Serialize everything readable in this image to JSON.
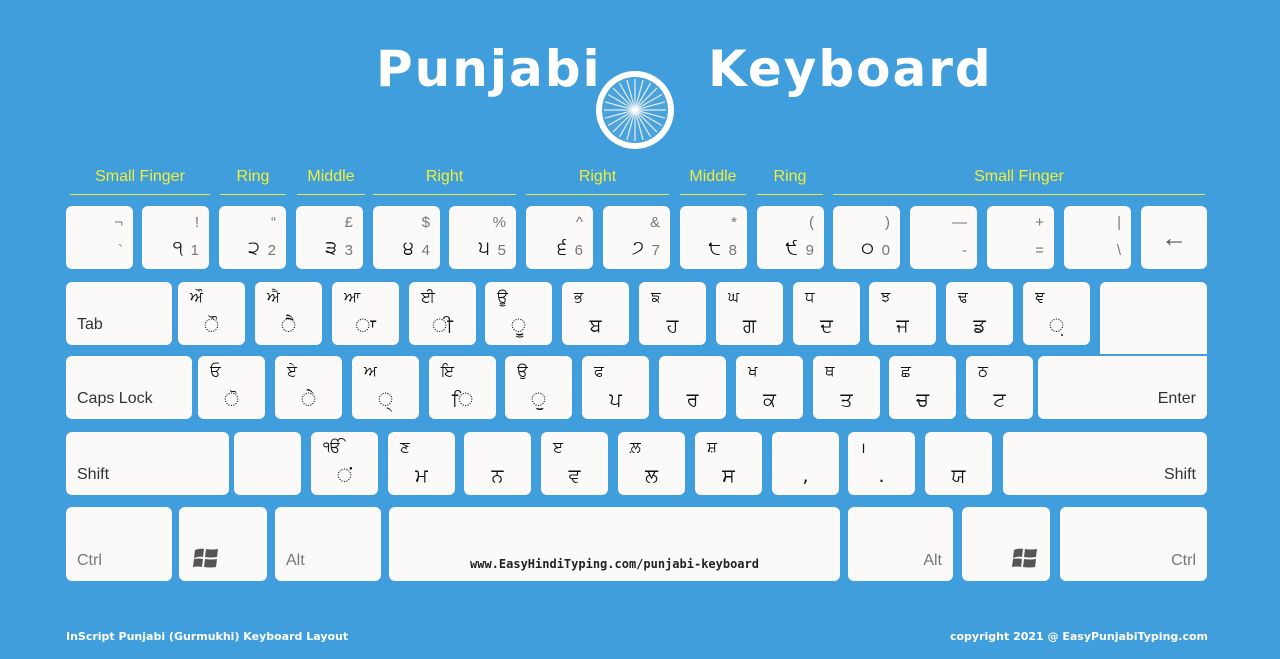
{
  "title": {
    "left": "Punjabi",
    "right": "Keyboard",
    "emblem": "ashoka-chakra-icon"
  },
  "fingers": [
    "Small Finger",
    "Ring",
    "Middle",
    "Right",
    "Right",
    "Middle",
    "Ring",
    "Small Finger"
  ],
  "row1": [
    {
      "shift": "¬",
      "base": "`",
      "pun": ""
    },
    {
      "shift": "!",
      "base": "1",
      "pun": "੧"
    },
    {
      "shift": "“",
      "base": "2",
      "pun": "੨"
    },
    {
      "shift": "£",
      "base": "3",
      "pun": "੩"
    },
    {
      "shift": "$",
      "base": "4",
      "pun": "੪"
    },
    {
      "shift": "%",
      "base": "5",
      "pun": "੫"
    },
    {
      "shift": "^",
      "base": "6",
      "pun": "੬"
    },
    {
      "shift": "&",
      "base": "7",
      "pun": "੭"
    },
    {
      "shift": "*",
      "base": "8",
      "pun": "੮"
    },
    {
      "shift": "(",
      "base": "9",
      "pun": "੯"
    },
    {
      "shift": ")",
      "base": "0",
      "pun": "੦"
    },
    {
      "shift": "—",
      "base": "-",
      "pun": ""
    },
    {
      "shift": "+",
      "base": "=",
      "pun": ""
    },
    {
      "shift": "|",
      "base": "\\",
      "pun": ""
    }
  ],
  "backspace": {
    "icon": "←"
  },
  "tab": {
    "label": "Tab"
  },
  "row2": [
    {
      "top": "ਔ",
      "main": "ੌ"
    },
    {
      "top": "ਐ",
      "main": "ੈ"
    },
    {
      "top": "ਆ",
      "main": "ਾ"
    },
    {
      "top": "ਈ",
      "main": "ੀ"
    },
    {
      "top": "ਊ",
      "main": "ੂ"
    },
    {
      "top": "ਭ",
      "main": "ਬ"
    },
    {
      "top": "ਙ",
      "main": "ਹ"
    },
    {
      "top": "ਘ",
      "main": "ਗ"
    },
    {
      "top": "ਧ",
      "main": "ਦ"
    },
    {
      "top": "ਝ",
      "main": "ਜ"
    },
    {
      "top": "ਢ",
      "main": "ਡ"
    },
    {
      "top": "ਞ",
      "main": "਼"
    }
  ],
  "caps": {
    "label": "Caps Lock"
  },
  "row3": [
    {
      "top": "ਓ",
      "main": "ੋ"
    },
    {
      "top": "ਏ",
      "main": "ੇ"
    },
    {
      "top": "ਅ",
      "main": "੍"
    },
    {
      "top": "ਇ",
      "main": "ਿ"
    },
    {
      "top": "ਉ",
      "main": "ੁ"
    },
    {
      "top": "ਫ",
      "main": "ਪ"
    },
    {
      "top": "",
      "main": "ਰ"
    },
    {
      "top": "ਖ",
      "main": "ਕ"
    },
    {
      "top": "ਥ",
      "main": "ਤ"
    },
    {
      "top": "ਛ",
      "main": "ਚ"
    },
    {
      "top": "ਠ",
      "main": "ਟ"
    }
  ],
  "enter": {
    "label": "Enter"
  },
  "shift_left": {
    "label": "Shift"
  },
  "row4": [
    {
      "top": "",
      "main": ""
    },
    {
      "top": "ੴ",
      "main": "ਂ"
    },
    {
      "top": "ਣ",
      "main": "ਮ"
    },
    {
      "top": "",
      "main": "ਨ"
    },
    {
      "top": "ੲ",
      "main": "ਵ"
    },
    {
      "top": "ਲ਼",
      "main": "ਲ"
    },
    {
      "top": "ਸ਼",
      "main": "ਸ"
    },
    {
      "top": "",
      "main": ","
    },
    {
      "top": "।",
      "main": "."
    },
    {
      "top": "",
      "main": "ਯ"
    }
  ],
  "shift_right": {
    "label": "Shift"
  },
  "bottom": {
    "ctrl_left": "Ctrl",
    "alt_left": "Alt",
    "space_text": "www.EasyHindiTyping.com/punjabi-keyboard",
    "alt_right": "Alt",
    "ctrl_right": "Ctrl"
  },
  "footer": {
    "left": "InScript Punjabi (Gurmukhi) Keyboard Layout",
    "right": "copyright 2021 @ EasyPunjabiTyping.com"
  }
}
